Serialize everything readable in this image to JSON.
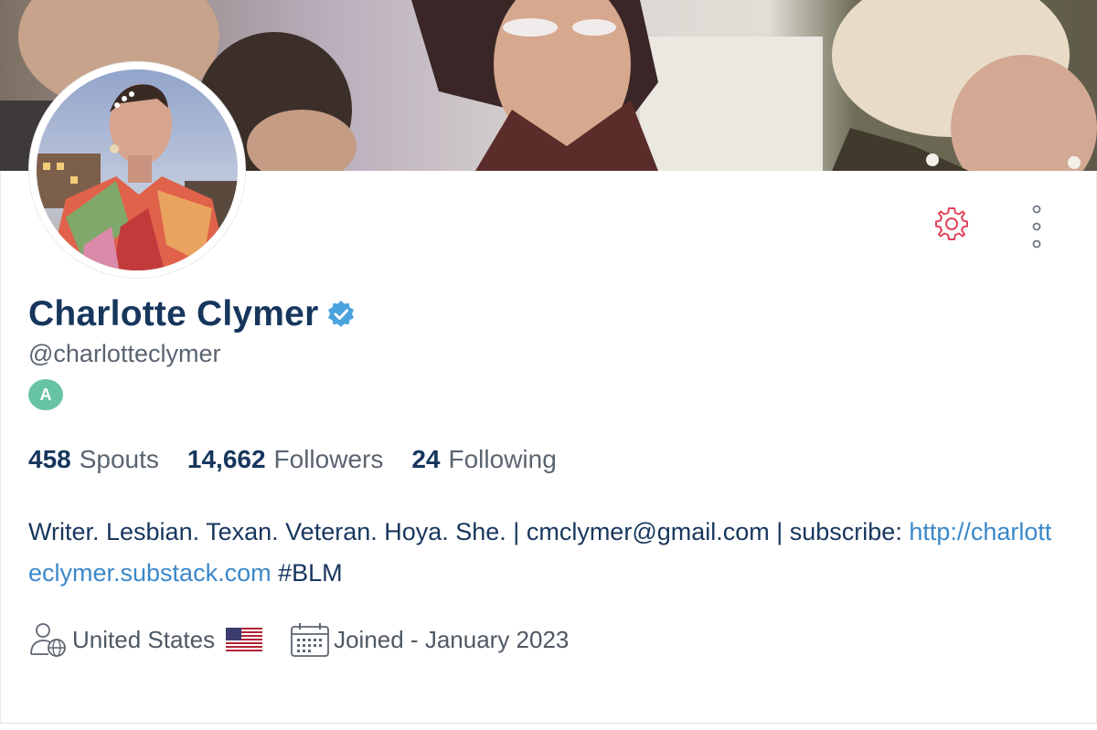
{
  "profile": {
    "display_name": "Charlotte Clymer",
    "handle": "@charlotteclymer",
    "tier_badge": "A",
    "verified": true
  },
  "stats": {
    "spouts_count": "458",
    "spouts_label": "Spouts",
    "followers_count": "14,662",
    "followers_label": "Followers",
    "following_count": "24",
    "following_label": "Following"
  },
  "bio": {
    "text": "Writer. Lesbian. Texan. Veteran. Hoya. She. | cmclymer@gmail.com | subscribe: ",
    "link": "http://charlotteclymer.substack.com",
    "hashtag": " #BLM"
  },
  "meta": {
    "location": "United States",
    "joined": "Joined - January 2023"
  },
  "icons": {
    "settings": "gear-icon",
    "more": "more-vertical-icon",
    "verified": "verified-check-icon",
    "location": "user-globe-icon",
    "flag": "us-flag-icon",
    "joined": "calendar-icon"
  },
  "colors": {
    "name": "#17365d",
    "link": "#3b88c9",
    "settings_icon": "#e0435a",
    "badge": "#66c3a6",
    "verified": "#4aa3df"
  }
}
